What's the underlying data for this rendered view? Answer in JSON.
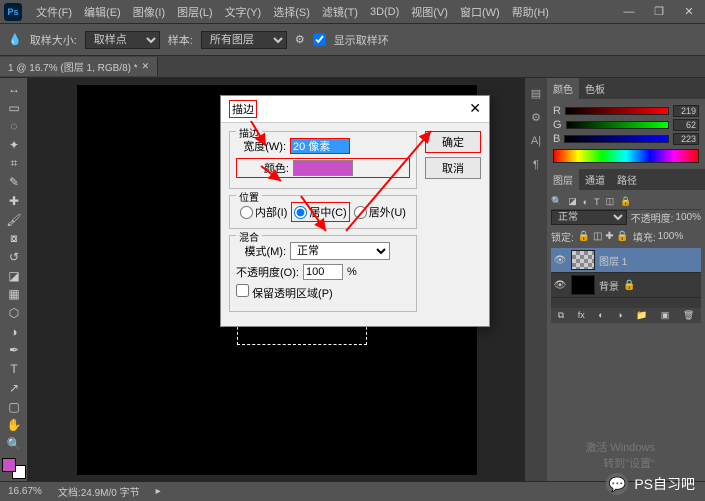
{
  "menubar": {
    "items": [
      "文件(F)",
      "编辑(E)",
      "图像(I)",
      "图层(L)",
      "文字(Y)",
      "选择(S)",
      "滤镜(T)",
      "3D(D)",
      "视图(V)",
      "窗口(W)",
      "帮助(H)"
    ]
  },
  "optionsbar": {
    "sample_size_label": "取样大小:",
    "sample_size_value": "取样点",
    "sample_label": "样本:",
    "sample_value": "所有图层",
    "show_ring_label": "显示取样环"
  },
  "tab": {
    "title": "1 @ 16.7% (图层 1, RGB/8) *"
  },
  "dialog": {
    "title": "描边",
    "ok": "确定",
    "cancel": "取消",
    "stroke_legend": "描边",
    "width_label": "宽度(W):",
    "width_value": "20 像素",
    "color_label": "颜色:",
    "color_value": "#c850c8",
    "position_legend": "位置",
    "pos_inside": "内部(I)",
    "pos_center": "居中(C)",
    "pos_outside": "居外(U)",
    "selected_position": "center",
    "blend_legend": "混合",
    "mode_label": "模式(M):",
    "mode_value": "正常",
    "opacity_label": "不透明度(O):",
    "opacity_value": "100",
    "opacity_unit": "%",
    "preserve_label": "保留透明区域(P)"
  },
  "color_panel": {
    "tab_color": "颜色",
    "tab_swatch": "色板",
    "r": "219",
    "g": "62",
    "b": "223"
  },
  "layer_panel": {
    "tab_layer": "图层",
    "tab_channel": "通道",
    "tab_path": "路径",
    "blend_mode": "正常",
    "opacity_label": "不透明度:",
    "opacity_value": "100%",
    "lock_label": "锁定:",
    "fill_label": "填充:",
    "fill_value": "100%",
    "layers": [
      {
        "name": "图层 1",
        "selected": true,
        "bg": false
      },
      {
        "name": "背景",
        "selected": false,
        "bg": true
      }
    ]
  },
  "statusbar": {
    "zoom": "16.67%",
    "doc": "文档:24.9M/0 字节"
  },
  "activate": {
    "line1": "激活 Windows",
    "line2": "转到\"设置\""
  },
  "watermark": {
    "text": "PS自习吧"
  }
}
